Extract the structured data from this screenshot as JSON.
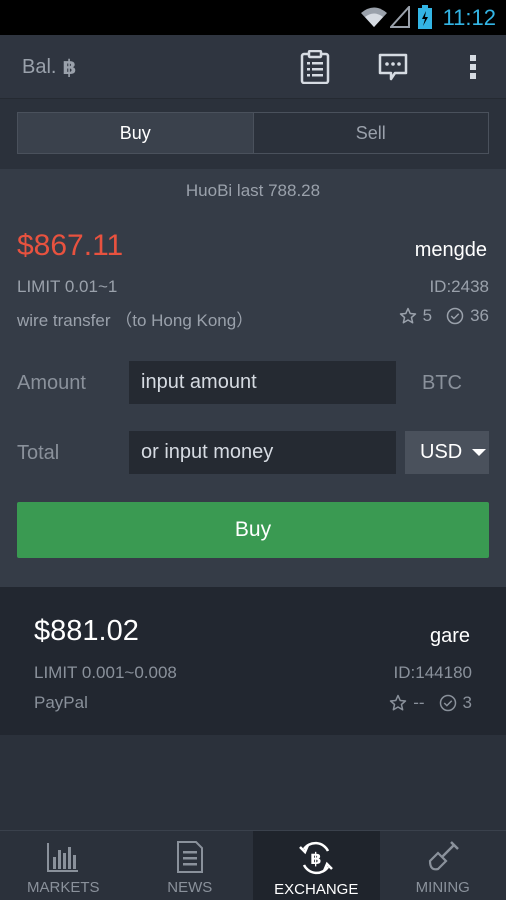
{
  "status": {
    "time": "11:12"
  },
  "appbar": {
    "balance_label": "Bal.",
    "currency_symbol": "฿"
  },
  "segment": {
    "buy": "Buy",
    "sell": "Sell"
  },
  "ticker": {
    "last_price": "HuoBi last 788.28"
  },
  "offer1": {
    "price": "$867.11",
    "seller": "mengde",
    "limit": "LIMIT 0.01~1",
    "id": "ID:2438",
    "method": "wire transfer  （to Hong Kong）",
    "rating": "5",
    "trades": "36"
  },
  "form": {
    "amount_label": "Amount",
    "amount_placeholder": "input amount",
    "amount_unit": "BTC",
    "total_label": "Total",
    "total_placeholder": "or input money",
    "currency": "USD",
    "submit": "Buy"
  },
  "offer2": {
    "price": "$881.02",
    "seller": "gare",
    "limit": "LIMIT 0.001~0.008",
    "id": "ID:144180",
    "method": "PayPal",
    "rating": "--",
    "trades": "3"
  },
  "nav": {
    "items": [
      {
        "label": "MARKETS",
        "icon": "bar-chart-icon"
      },
      {
        "label": "NEWS",
        "icon": "news-icon"
      },
      {
        "label": "EXCHANGE",
        "icon": "bitcoin-exchange-icon"
      },
      {
        "label": "MINING",
        "icon": "shovel-icon"
      }
    ],
    "active_index": 2
  },
  "colors": {
    "accent_green": "#3a9a52",
    "price_red": "#e8523f",
    "status_blue": "#33b5e5"
  }
}
